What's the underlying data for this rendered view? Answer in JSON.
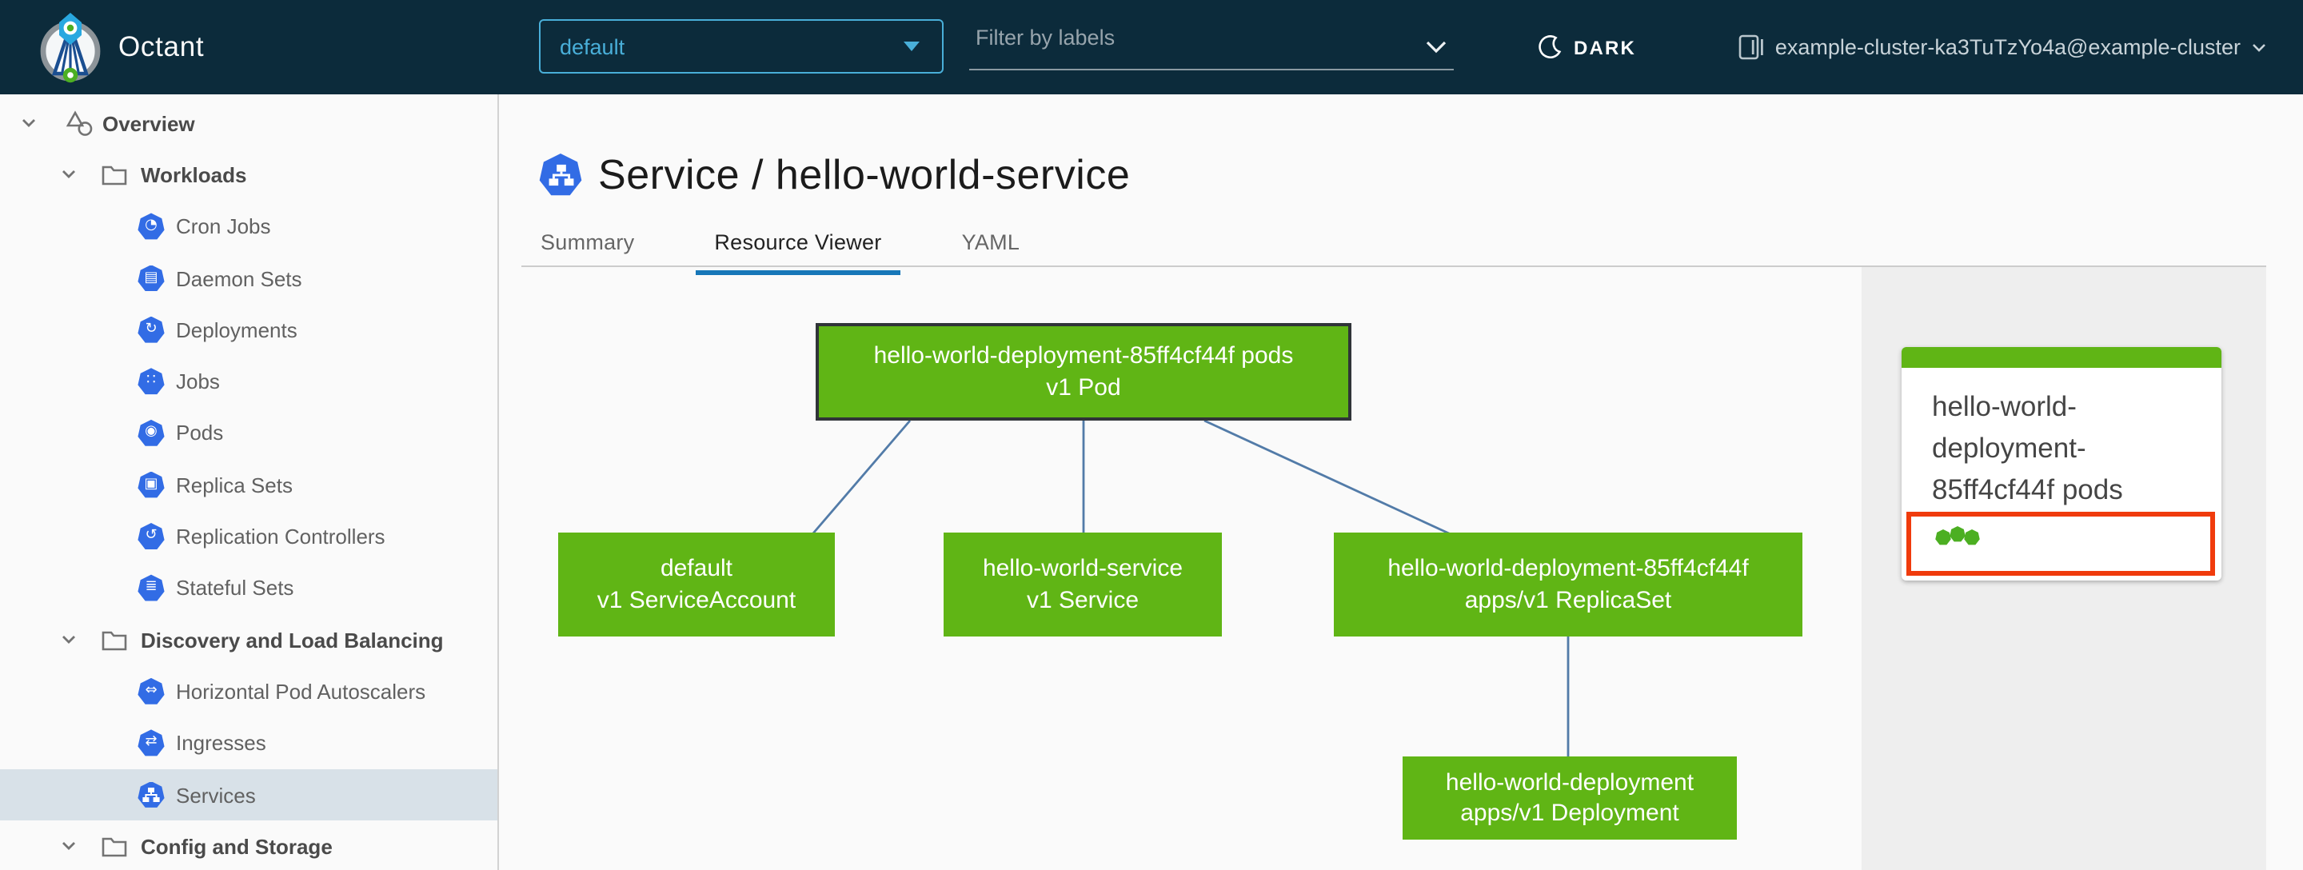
{
  "header": {
    "app_name": "Octant",
    "namespace_selector": {
      "value": "default"
    },
    "label_filter": {
      "placeholder": "Filter by labels"
    },
    "theme_toggle": {
      "label": "DARK",
      "icon": "moon-icon"
    },
    "context": {
      "label": "example-cluster-ka3TuTzYo4a@example-cluster",
      "icon": "cluster-icon"
    }
  },
  "sidebar": {
    "items": [
      {
        "label": "Overview",
        "level": 0,
        "type": "group",
        "icon": "applications-icon",
        "expanded": true
      },
      {
        "label": "Workloads",
        "level": 1,
        "type": "group",
        "icon": "folder-icon",
        "expanded": true
      },
      {
        "label": "Cron Jobs",
        "level": 2,
        "icon": "cronjob-icon",
        "glyph": "◔"
      },
      {
        "label": "Daemon Sets",
        "level": 2,
        "icon": "daemonset-icon",
        "glyph": "▤"
      },
      {
        "label": "Deployments",
        "level": 2,
        "icon": "deployment-icon",
        "glyph": "↻"
      },
      {
        "label": "Jobs",
        "level": 2,
        "icon": "job-icon",
        "glyph": "∷"
      },
      {
        "label": "Pods",
        "level": 2,
        "icon": "pod-icon",
        "glyph": "◉"
      },
      {
        "label": "Replica Sets",
        "level": 2,
        "icon": "replicaset-icon",
        "glyph": "▣"
      },
      {
        "label": "Replication Controllers",
        "level": 2,
        "icon": "replicationcontroller-icon",
        "glyph": "↺"
      },
      {
        "label": "Stateful Sets",
        "level": 2,
        "icon": "statefulset-icon",
        "glyph": "≣"
      },
      {
        "label": "Discovery and Load Balancing",
        "level": 1,
        "type": "group",
        "icon": "folder-icon",
        "expanded": true
      },
      {
        "label": "Horizontal Pod Autoscalers",
        "level": 2,
        "icon": "hpa-icon",
        "glyph": "⇔"
      },
      {
        "label": "Ingresses",
        "level": 2,
        "icon": "ingress-icon",
        "glyph": "⇄"
      },
      {
        "label": "Services",
        "level": 2,
        "icon": "service-icon",
        "selected": true
      },
      {
        "label": "Config and Storage",
        "level": 1,
        "type": "group",
        "icon": "folder-icon",
        "expanded": true
      }
    ]
  },
  "main": {
    "title": "Service / hello-world-service",
    "title_icon": "service-icon",
    "tabs": [
      {
        "label": "Summary",
        "active": false
      },
      {
        "label": "Resource Viewer",
        "active": true
      },
      {
        "label": "YAML",
        "active": false
      }
    ]
  },
  "graph": {
    "nodes": [
      {
        "id": "pod",
        "name": "hello-world-deployment-85ff4cf44f pods",
        "kind": "v1 Pod",
        "selected": true
      },
      {
        "id": "serviceaccount",
        "name": "default",
        "kind": "v1 ServiceAccount",
        "selected": false
      },
      {
        "id": "service",
        "name": "hello-world-service",
        "kind": "v1 Service",
        "selected": false
      },
      {
        "id": "replicaset",
        "name": "hello-world-deployment-85ff4cf44f",
        "kind": "apps/v1 ReplicaSet",
        "selected": false
      },
      {
        "id": "deployment",
        "name": "hello-world-deployment",
        "kind": "apps/v1 Deployment",
        "selected": false
      }
    ],
    "edges": [
      {
        "from": "pod",
        "to": "serviceaccount"
      },
      {
        "from": "pod",
        "to": "service"
      },
      {
        "from": "pod",
        "to": "replicaset"
      },
      {
        "from": "replicaset",
        "to": "deployment"
      }
    ]
  },
  "detail_panel": {
    "card": {
      "title": "hello-world-deployment-85ff4cf44f pods",
      "status_dot_count": 3,
      "highlighted": true
    }
  },
  "colors": {
    "header_bg": "#0C2B3B",
    "accent_blue": "#49AFD9",
    "k8s_icon_blue": "#326CE5",
    "node_green": "#60B515",
    "status_dot_green": "#4CAF22",
    "edge_blue": "#527BA8",
    "tab_underline": "#1777B8",
    "highlight_red": "#F03B0C",
    "selected_row_bg": "#D8E1E8",
    "panel_bg": "#EEEEEE",
    "page_bg": "#FAFAFA"
  }
}
